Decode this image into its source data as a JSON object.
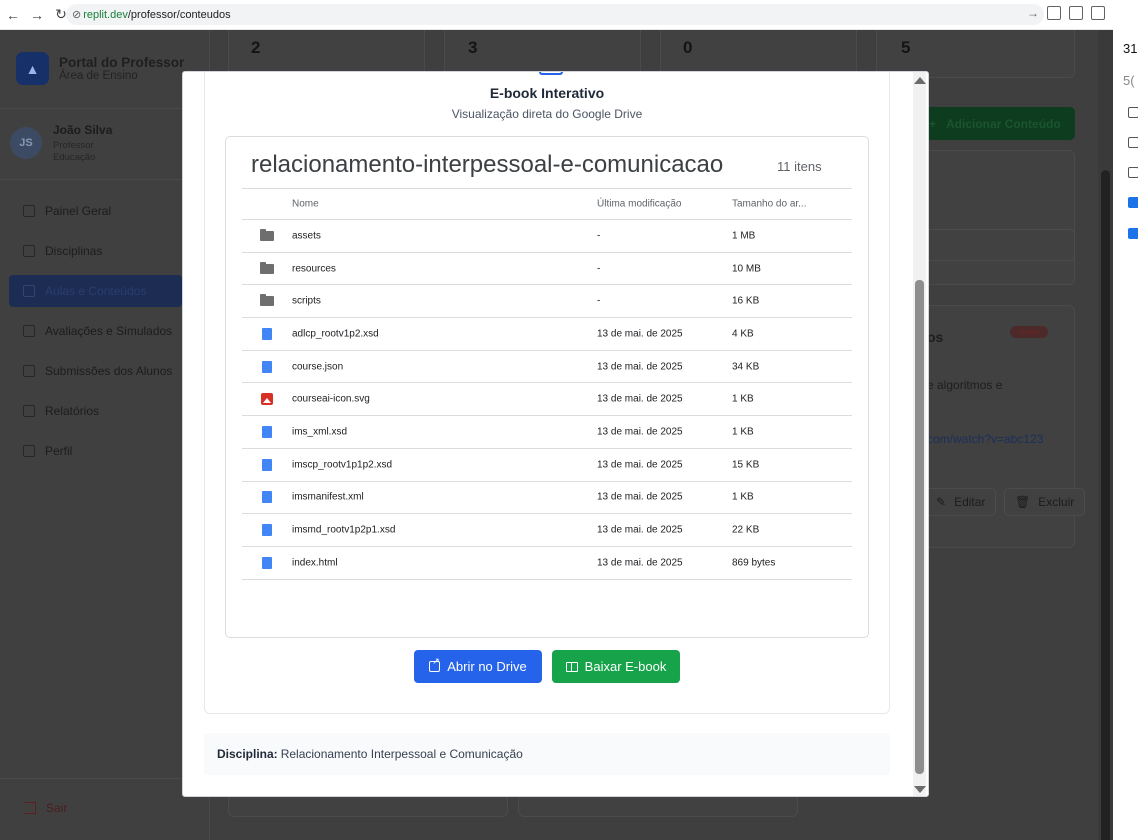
{
  "browser": {
    "url_host": "replit.dev",
    "url_path": "/professor/conteudos"
  },
  "sidebar": {
    "brand_title": "Portal do Professor",
    "brand_subtitle": "Área de Ensino",
    "user": {
      "initials": "JS",
      "name": "João Silva",
      "role": "Professor",
      "department": "Educação"
    },
    "items": [
      {
        "label": "Painel Geral",
        "active": false
      },
      {
        "label": "Disciplinas",
        "active": false
      },
      {
        "label": "Aulas e Conteúdos",
        "active": true
      },
      {
        "label": "Avaliações e Simulados",
        "active": false
      },
      {
        "label": "Submissões dos Alunos",
        "active": false
      },
      {
        "label": "Relatórios",
        "active": false
      },
      {
        "label": "Perfil",
        "active": false
      }
    ],
    "logout_label": "Sair"
  },
  "background": {
    "stats": [
      "2",
      "3",
      "0",
      "5"
    ],
    "add_button": "Adicionar Conteúdo",
    "badge": "video",
    "partial_title": "os",
    "partial_desc": "e algoritmos e",
    "partial_link": "com/watch?v=abc123",
    "edit_label": "Editar",
    "delete_label": "Excluir"
  },
  "right_strip": {
    "numbers": [
      "31",
      "5("
    ]
  },
  "modal": {
    "title": "E-book Interativo",
    "subtitle": "Visualização direta do Google Drive",
    "drive": {
      "folder_name": "relacionamento-interpessoal-e-comunicacao",
      "count": "11 itens",
      "columns": {
        "name": "Nome",
        "modified": "Última modificação",
        "size": "Tamanho do ar..."
      },
      "rows": [
        {
          "icon": "folder",
          "name": "assets",
          "modified": "-",
          "size": "1 MB"
        },
        {
          "icon": "folder",
          "name": "resources",
          "modified": "-",
          "size": "10 MB"
        },
        {
          "icon": "folder",
          "name": "scripts",
          "modified": "-",
          "size": "16 KB"
        },
        {
          "icon": "doc",
          "name": "adlcp_rootv1p2.xsd",
          "modified": "13 de mai. de 2025",
          "size": "4 KB"
        },
        {
          "icon": "doc",
          "name": "course.json",
          "modified": "13 de mai. de 2025",
          "size": "34 KB"
        },
        {
          "icon": "image",
          "name": "courseai-icon.svg",
          "modified": "13 de mai. de 2025",
          "size": "1 KB"
        },
        {
          "icon": "doc",
          "name": "ims_xml.xsd",
          "modified": "13 de mai. de 2025",
          "size": "1 KB"
        },
        {
          "icon": "doc",
          "name": "imscp_rootv1p1p2.xsd",
          "modified": "13 de mai. de 2025",
          "size": "15 KB"
        },
        {
          "icon": "doc",
          "name": "imsmanifest.xml",
          "modified": "13 de mai. de 2025",
          "size": "1 KB"
        },
        {
          "icon": "doc",
          "name": "imsmd_rootv1p2p1.xsd",
          "modified": "13 de mai. de 2025",
          "size": "22 KB"
        },
        {
          "icon": "doc",
          "name": "index.html",
          "modified": "13 de mai. de 2025",
          "size": "869 bytes"
        }
      ]
    },
    "open_drive_label": "Abrir no Drive",
    "download_label": "Baixar E-book",
    "discipline_label": "Disciplina:",
    "discipline_value": "Relacionamento Interpessoal e Comunicação"
  }
}
